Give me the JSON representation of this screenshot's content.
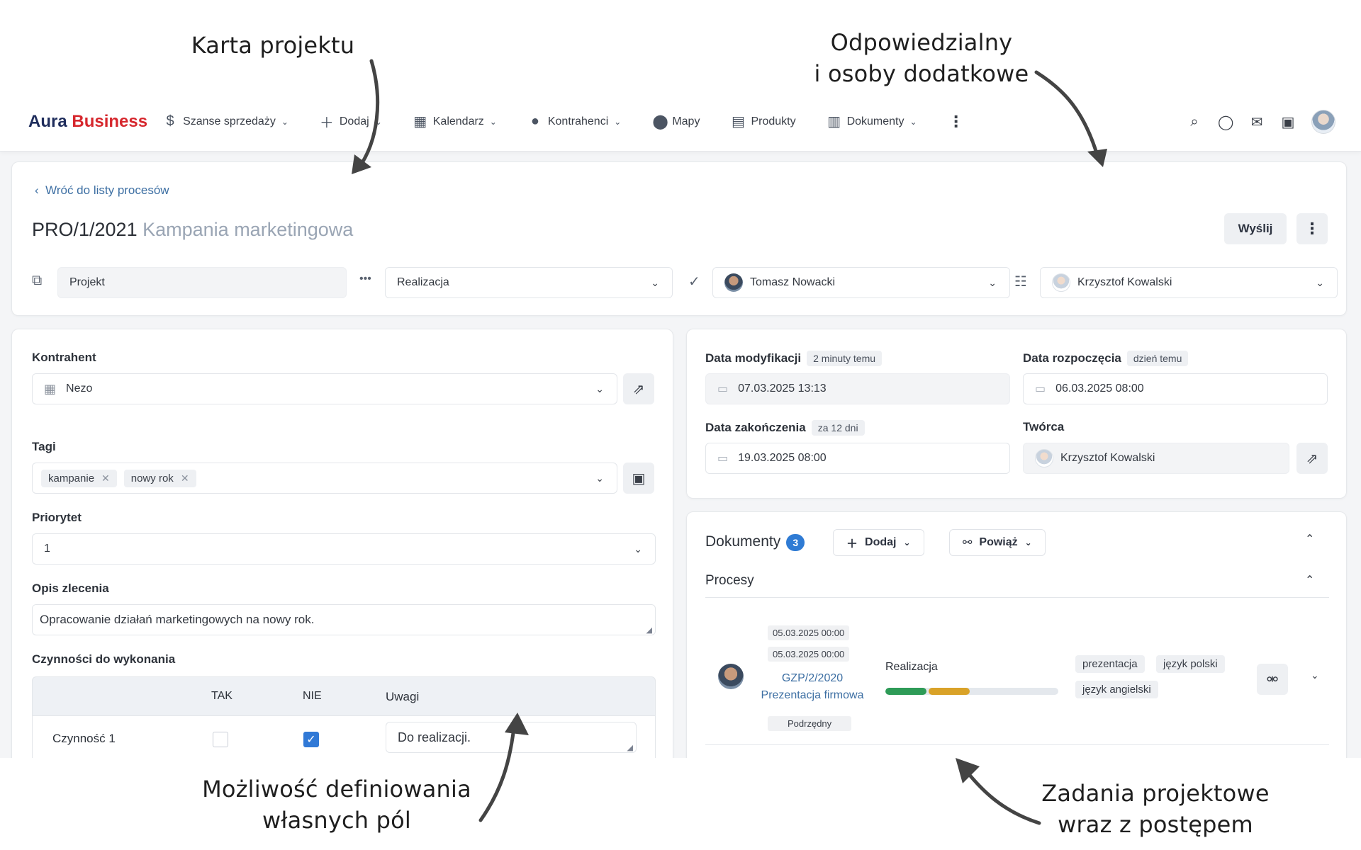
{
  "annotations": {
    "card": "Karta projektu",
    "responsible_line1": "Odpowiedzialny",
    "responsible_line2": "i osoby dodatkowe",
    "fields_line1": "Możliwość definiowania",
    "fields_line2": "własnych pól",
    "tasks_line1": "Zadania projektowe",
    "tasks_line2": "wraz z postępem"
  },
  "nav": {
    "logo_part1": "Aura",
    "logo_part2": "Business",
    "items": [
      {
        "label": "Szanse sprzedaży",
        "icon": "dollar-icon"
      },
      {
        "label": "Dodaj",
        "icon": "plus-icon"
      },
      {
        "label": "Kalendarz",
        "icon": "calendar-icon"
      },
      {
        "label": "Kontrahenci",
        "icon": "person-icon"
      },
      {
        "label": "Mapy",
        "icon": "map-pin-icon"
      },
      {
        "label": "Produkty",
        "icon": "book-icon"
      },
      {
        "label": "Dokumenty",
        "icon": "table-icon"
      }
    ]
  },
  "header": {
    "back": "Wróć do listy procesów",
    "number": "PRO/1/2021",
    "name": "Kampania marketingowa",
    "send": "Wyślij",
    "type": "Projekt",
    "stage": "Realizacja",
    "responsible": "Tomasz Nowacki",
    "additional": "Krzysztof Kowalski"
  },
  "left": {
    "contractor_label": "Kontrahent",
    "contractor_value": "Nezo",
    "tags_label": "Tagi",
    "tags": [
      "kampanie",
      "nowy rok"
    ],
    "priority_label": "Priorytet",
    "priority_value": "1",
    "desc_label": "Opis zlecenia",
    "desc_value": "Opracowanie działań marketingowych na nowy rok.",
    "tasks_label": "Czynności do wykonania",
    "tasks_cols": [
      "TAK",
      "NIE",
      "Uwagi"
    ],
    "tasks_rows": [
      {
        "name": "Czynność 1",
        "tak": false,
        "nie": true,
        "notes": "Do realizacji."
      }
    ]
  },
  "dates": {
    "modified_label": "Data modyfikacji",
    "modified_badge": "2 minuty temu",
    "modified_value": "07.03.2025 13:13",
    "start_label": "Data rozpoczęcia",
    "start_badge": "dzień temu",
    "start_value": "06.03.2025 08:00",
    "end_label": "Data zakończenia",
    "end_badge": "za 12 dni",
    "end_value": "19.03.2025 08:00",
    "creator_label": "Twórca",
    "creator_value": "Krzysztof Kowalski"
  },
  "documents": {
    "title": "Dokumenty",
    "count": "3",
    "add": "Dodaj",
    "link": "Powiąż",
    "section": "Procesy",
    "process": {
      "date1": "05.03.2025 00:00",
      "date2": "05.03.2025 00:00",
      "number": "GZP/2/2020",
      "name": "Prezentacja firmowa",
      "role": "Podrzędny",
      "stage": "Realizacja",
      "progress_fraction": 0.4,
      "tags": [
        "prezentacja",
        "język polski",
        "język angielski"
      ]
    }
  },
  "colors": {
    "accent": "#2f7bd4",
    "link": "#3d6fa3",
    "progress_done": "#2e9b57",
    "progress_current": "#d9a228",
    "brand_red": "#d6272d",
    "brand_navy": "#1f2d5c"
  }
}
